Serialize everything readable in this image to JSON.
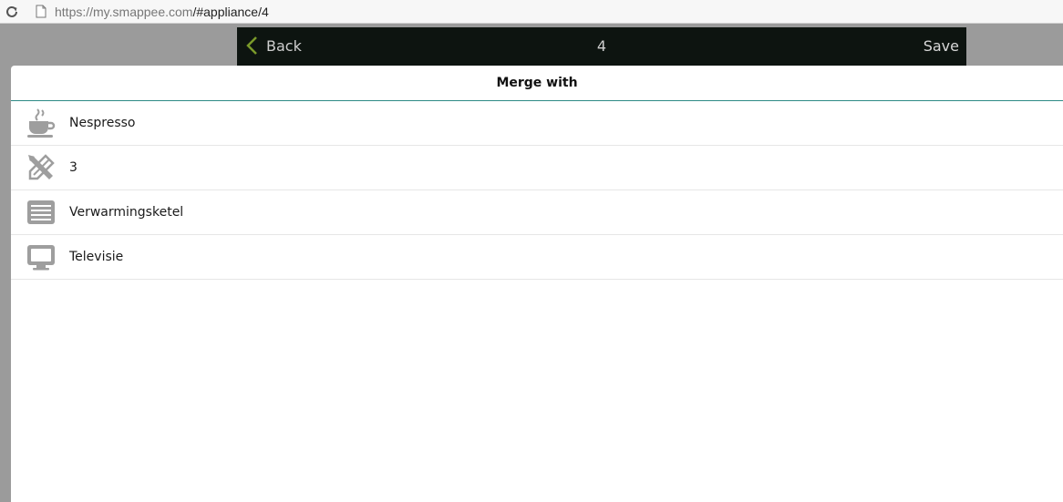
{
  "browser": {
    "url_host": "https://my.smappee.com",
    "url_path": "/#appliance/4"
  },
  "header": {
    "back_label": "Back",
    "title": "4",
    "save_label": "Save"
  },
  "dialog": {
    "title": "Merge with",
    "items": [
      {
        "label": "Nespresso",
        "icon": "coffee-cup-icon"
      },
      {
        "label": "3",
        "icon": "tools-icon"
      },
      {
        "label": "Verwarmingsketel",
        "icon": "heater-icon"
      },
      {
        "label": "Televisie",
        "icon": "television-icon"
      }
    ]
  },
  "colors": {
    "header_bg": "#0d1410",
    "back_chevron": "#7a9a2a",
    "divider_accent": "#2d8a86",
    "icon_gray": "#9e9e9e"
  }
}
